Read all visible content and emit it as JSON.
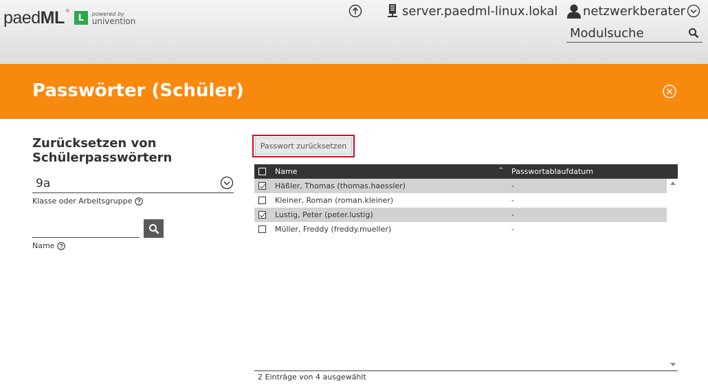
{
  "header": {
    "logo_text_light": "paed",
    "logo_text_bold": "ML",
    "logo_reg": "®",
    "logo_badge": "L",
    "powered_by": "powered by",
    "powered_company": "univention",
    "upload_icon": "arrow-up-circle-icon",
    "host": "server.paedml-linux.lokal",
    "user": "netzwerkberater",
    "module_search_placeholder": "Modulsuche"
  },
  "title_bar": {
    "title": "Passwörter (Schüler)",
    "accent": "#f8890f"
  },
  "left_panel": {
    "heading": "Zurücksetzen von Schülerpasswörtern",
    "class_value": "9a",
    "class_label": "Klasse oder Arbeitsgruppe",
    "name_value": "",
    "name_label": "Name"
  },
  "toolbar": {
    "reset_label": "Passwort zurücksetzen"
  },
  "grid": {
    "columns": [
      "Name",
      "Passwortablaufdatum"
    ],
    "sort_indicator": "^",
    "rows": [
      {
        "name": "Häßler, Thomas (thomas.haessler)",
        "expiry": "-",
        "checked": true
      },
      {
        "name": "Kleiner, Roman (roman.kleiner)",
        "expiry": "-",
        "checked": false
      },
      {
        "name": "Lustig, Peter (peter.lustig)",
        "expiry": "-",
        "checked": true
      },
      {
        "name": "Müller, Freddy (freddy.mueller)",
        "expiry": "-",
        "checked": false
      }
    ],
    "status": "2 Einträge von 4 ausgewählt"
  }
}
